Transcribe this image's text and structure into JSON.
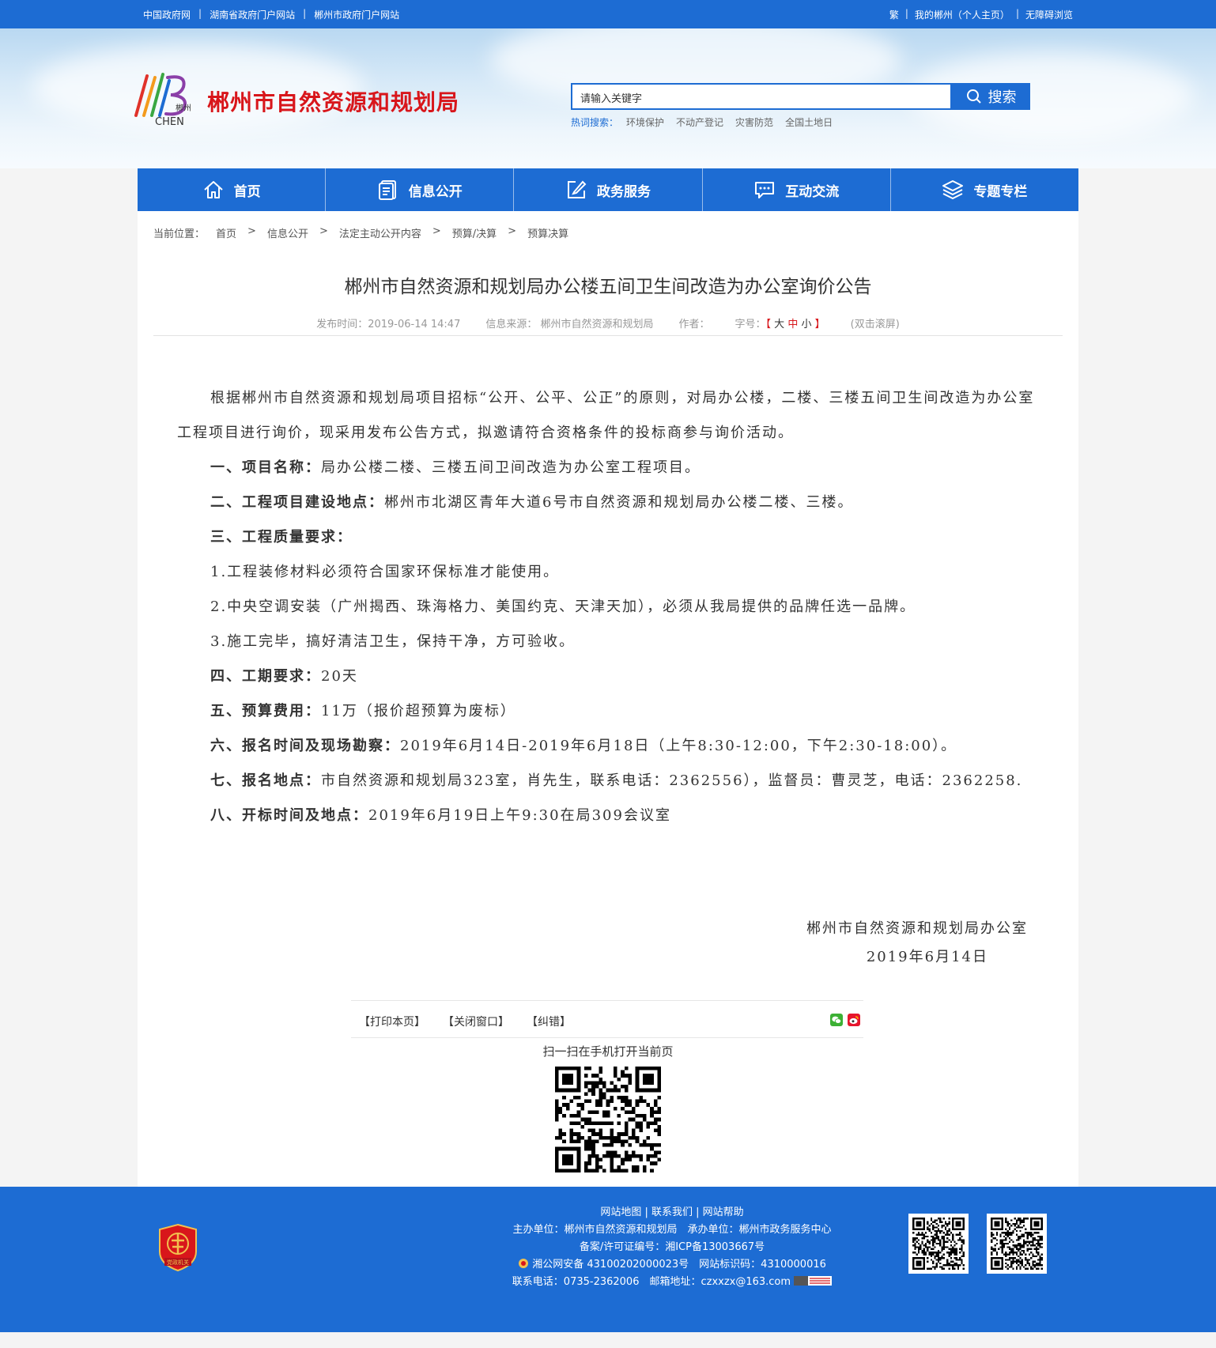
{
  "topbar": {
    "left_links": [
      "中国政府网",
      "湖南省政府门户网站",
      "郴州市政府门户网站"
    ],
    "right_links": [
      "繁",
      "我的郴州（个人主页）",
      "无障碍浏览"
    ]
  },
  "header": {
    "logo_text": "郴州",
    "logo_sub": "CHEN",
    "site_title": "郴州市自然资源和规划局",
    "search_placeholder": "请输入关键字",
    "search_button": "搜索",
    "hot_label": "热词搜索：",
    "hot_words": [
      "环境保护",
      "不动产登记",
      "灾害防范",
      "全国土地日"
    ]
  },
  "nav": [
    {
      "label": "首页",
      "icon": "home-icon"
    },
    {
      "label": "信息公开",
      "icon": "document-icon"
    },
    {
      "label": "政务服务",
      "icon": "edit-icon"
    },
    {
      "label": "互动交流",
      "icon": "chat-icon"
    },
    {
      "label": "专题专栏",
      "icon": "layers-icon"
    }
  ],
  "breadcrumb": [
    "当前位置：",
    "首页",
    ">",
    "信息公开",
    ">",
    "法定主动公开内容",
    ">",
    "预算/决算",
    ">",
    "预算决算"
  ],
  "article": {
    "title": "郴州市自然资源和规划局办公楼五间卫生间改造为办公室询价公告",
    "publish_time": "发布时间：2019-06-14 14:47",
    "source": "信息来源： 郴州市自然资源和规划局",
    "author": "作者：",
    "font_size_label": "字号：",
    "font_size_open": "【",
    "font_size_big": "大",
    "font_size_mid": "中",
    "font_size_small": "小",
    "font_size_close": "】",
    "dblclick": "(双击滚屏)",
    "intro": "根据郴州市自然资源和规划局项目招标“公开、公平、公正”的原则，对局办公楼，二楼、三楼五间卫生间改造为办公室工程项目进行询价，现采用发布公告方式，拟邀请符合资格条件的投标商参与询价活动。",
    "p1_label": "一、项目名称：",
    "p1_text": "局办公楼二楼、三楼五间卫间改造为办公室工程项目。",
    "p2_label": "二、工程项目建设地点：",
    "p2_text": "郴州市北湖区青年大道6号市自然资源和规划局办公楼二楼、三楼。",
    "p3_label": "三、工程质量要求：",
    "p3_1": "1.工程装修材料必须符合国家环保标准才能使用。",
    "p3_2": "2.中央空调安装（广州揭西、珠海格力、美国约克、天津天加），必须从我局提供的品牌任选一品牌。",
    "p3_3": "3.施工完毕，搞好清洁卫生，保持干净，方可验收。",
    "p4_label": "四、工期要求：",
    "p4_text": "20天",
    "p5_label": "五、预算费用：",
    "p5_text": "11万（报价超预算为废标）",
    "p6_label": "六、报名时间及现场勘察：",
    "p6_text": "2019年6月14日-2019年6月18日（上午8:30-12:00，下午2:30-18:00）。",
    "p7_label": "七、报名地点：",
    "p7_text": "市自然资源和规划局323室，肖先生，联系电话：2362556），监督员：曹灵芝，电话：2362258.",
    "p8_label": "八、开标时间及地点：",
    "p8_text": "2019年6月19日上午9:30在局309会议室",
    "sign_org": "郴州市自然资源和规划局办公室",
    "sign_date": "2019年6月14日"
  },
  "tools": {
    "print": "【打印本页】",
    "close": "【关闭窗口】",
    "correct": "【纠错】",
    "scan_text": "扫一扫在手机打开当前页"
  },
  "footer": {
    "links": "网站地图 | 联系我们 | 网站帮助",
    "host": "主办单位：郴州市自然资源和规划局　承办单位：郴州市政务服务中心",
    "icp": "备案/许可证编号：湘ICP备13003667号",
    "police": "湘公网安备 43100202000023号　网站标识码：4310000016",
    "contact": "联系电话：0735-2362006　邮箱地址：czxxzx@163.com",
    "badge_text": "党政机关"
  },
  "colors": {
    "primary": "#1d6cd3",
    "title_red": "#d8161b"
  }
}
